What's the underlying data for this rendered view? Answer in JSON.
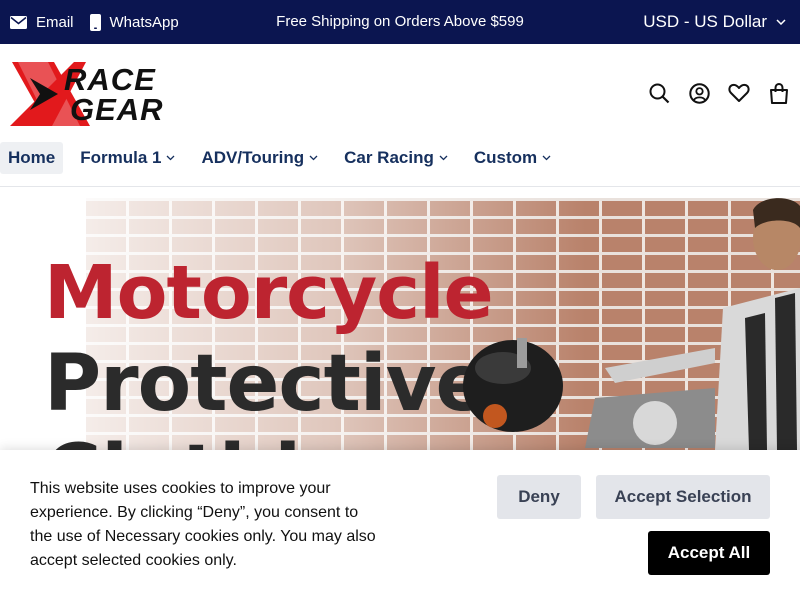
{
  "topbar": {
    "email_label": "Email",
    "whatsapp_label": "WhatsApp",
    "promo_text": "Free Shipping on Orders Above $599",
    "currency_label": "USD - US Dollar",
    "background_color": "#0b1550"
  },
  "brand": {
    "logo_line1": "RACE",
    "logo_line2": "GEAR",
    "accent_color": "#e2191c"
  },
  "header_icons": [
    "search-icon",
    "account-icon",
    "heart-icon",
    "bag-icon"
  ],
  "nav": {
    "items": [
      {
        "label": "Home",
        "active": true,
        "has_dropdown": false
      },
      {
        "label": "Formula 1",
        "active": false,
        "has_dropdown": true
      },
      {
        "label": "ADV/Touring",
        "active": false,
        "has_dropdown": true
      },
      {
        "label": "Car Racing",
        "active": false,
        "has_dropdown": true
      },
      {
        "label": "Custom",
        "active": false,
        "has_dropdown": true
      }
    ]
  },
  "hero": {
    "line1": "Motorcycle",
    "line2": "Protective",
    "line3": "Clothing"
  },
  "cookie_banner": {
    "message": "This website uses cookies to improve your experience. By clicking “Deny”, you consent to the use of Necessary cookies only. You may also accept selected cookies only.",
    "deny_label": "Deny",
    "accept_selection_label": "Accept Selection",
    "accept_all_label": "Accept All"
  }
}
